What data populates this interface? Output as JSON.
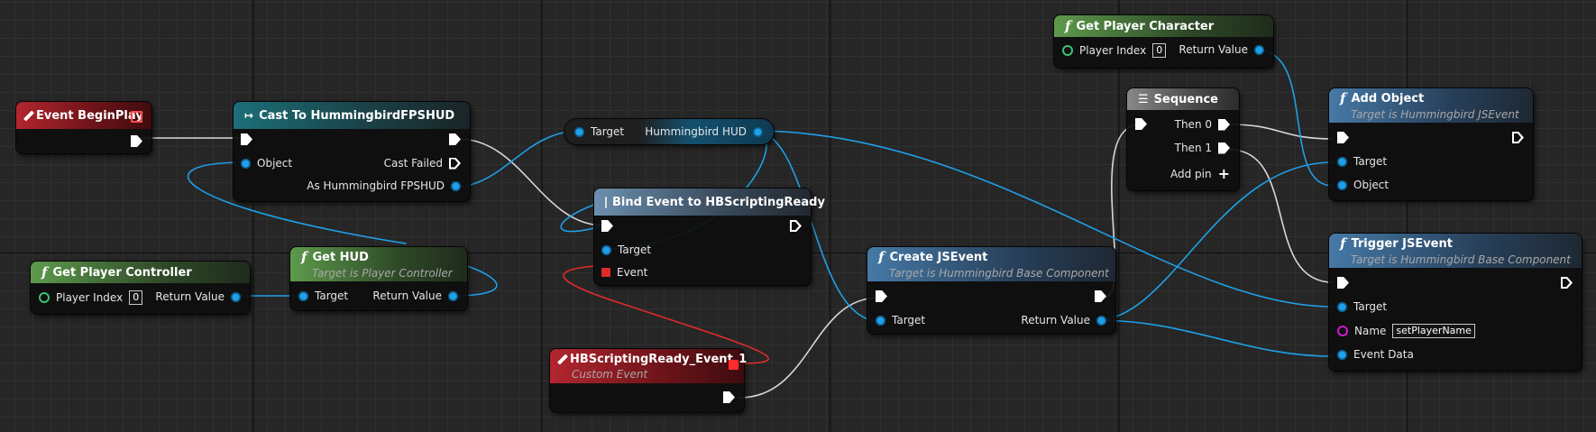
{
  "nodes": {
    "begin_play": {
      "title": "Event BeginPlay"
    },
    "cast": {
      "title": "Cast To HummingbirdFPSHUD",
      "object": "Object",
      "cast_failed": "Cast Failed",
      "as_hud": "As Hummingbird FPSHUD"
    },
    "get_player_controller": {
      "title": "Get Player Controller",
      "player_index": "Player Index",
      "index_value": "0",
      "return_value": "Return Value"
    },
    "get_hud": {
      "title": "Get HUD",
      "subtitle": "Target is Player Controller",
      "target": "Target",
      "return_value": "Return Value"
    },
    "hud_var": {
      "target": "Target",
      "label": "Hummingbird HUD"
    },
    "bind_event": {
      "title": "Bind Event to HBScriptingReady",
      "target": "Target",
      "event": "Event"
    },
    "custom_event": {
      "title": "HBScriptingReady_Event_1",
      "subtitle": "Custom Event"
    },
    "create_jsevent": {
      "title": "Create JSEvent",
      "subtitle": "Target is Hummingbird Base Component",
      "target": "Target",
      "return_value": "Return Value"
    },
    "get_player_character": {
      "title": "Get Player Character",
      "player_index": "Player Index",
      "index_value": "0",
      "return_value": "Return Value"
    },
    "sequence": {
      "title": "Sequence",
      "then0": "Then 0",
      "then1": "Then 1",
      "add_pin": "Add pin"
    },
    "add_object": {
      "title": "Add Object",
      "subtitle": "Target is Hummingbird JSEvent",
      "target": "Target",
      "object": "Object"
    },
    "trigger_jsevent": {
      "title": "Trigger JSEvent",
      "subtitle": "Target is Hummingbird Base Component",
      "target": "Target",
      "name": "Name",
      "name_value": "setPlayerName",
      "event_data": "Event Data"
    }
  },
  "icons": {
    "function": "function-icon",
    "event": "event-diamond-icon",
    "cast": "cast-arrow-icon",
    "sequence": "sequence-icon",
    "bind": "bind-event-icon"
  },
  "colors": {
    "exec_wire": "#e8e8e8",
    "object_wire": "#1fa0e8",
    "delegate_wire": "#e02a2a",
    "event_header": "#b3262f",
    "pure_header": "#5e9a4c",
    "cast_header": "#1c6f78",
    "call_header": "#4679a6"
  }
}
